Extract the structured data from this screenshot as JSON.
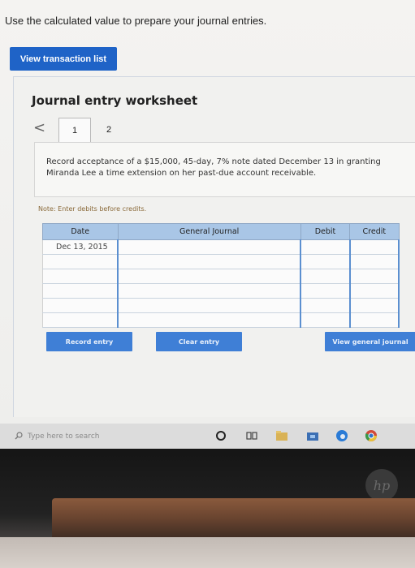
{
  "instruction": "Use the calculated value to prepare your journal entries.",
  "view_transaction_list_label": "View transaction list",
  "worksheet": {
    "title": "Journal entry worksheet",
    "prev_arrow": "<",
    "tabs": [
      "1",
      "2"
    ],
    "question": "Record acceptance of a $15,000, 45-day, 7% note dated December 13 in granting Miranda Lee a time extension on her past-due account receivable.",
    "note": "Note: Enter debits before credits."
  },
  "journal_table": {
    "headers": [
      "Date",
      "General Journal",
      "Debit",
      "Credit"
    ],
    "rows": [
      [
        "Dec 13, 2015",
        "",
        "",
        ""
      ],
      [
        "",
        "",
        "",
        ""
      ],
      [
        "",
        "",
        "",
        ""
      ],
      [
        "",
        "",
        "",
        ""
      ],
      [
        "",
        "",
        "",
        ""
      ],
      [
        "",
        "",
        "",
        ""
      ]
    ]
  },
  "actions": {
    "record_entry": "Record entry",
    "clear_entry": "Clear entry",
    "view_general_journal": "View general journal"
  },
  "taskbar": {
    "search_placeholder": "Type here to search"
  },
  "colors": {
    "primary_button": "#1f63c7",
    "action_button": "#3f7fd6",
    "table_header": "#a9c6e6",
    "input_border": "#5b8fd0"
  }
}
